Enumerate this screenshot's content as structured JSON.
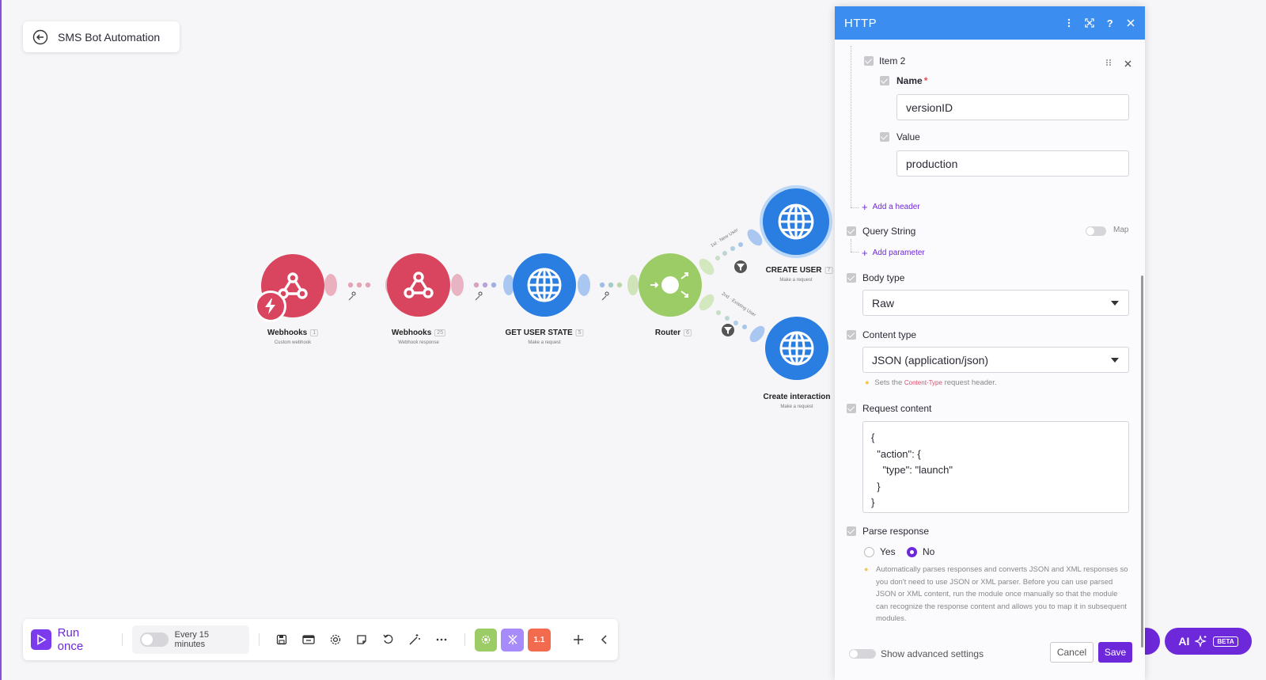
{
  "scenario": {
    "title": "SMS Bot Automation"
  },
  "nodes": [
    {
      "name": "Webhooks",
      "num": "1",
      "sub": "Custom webhook"
    },
    {
      "name": "Webhooks",
      "num": "25",
      "sub": "Webhook response"
    },
    {
      "name": "GET USER STATE",
      "num": "5",
      "sub": "Make a request"
    },
    {
      "name": "Router",
      "num": "6",
      "sub": ""
    },
    {
      "name": "CREATE USER",
      "num": "7",
      "sub": "Make a request"
    },
    {
      "name": "Create interaction",
      "num": "",
      "sub": "Make a request"
    }
  ],
  "routes": {
    "r1": "1st · New User",
    "r2": "2nd · Existing User"
  },
  "toolbar": {
    "run_once": "Run once",
    "schedule": "Every 15 minutes",
    "badge": "1.1"
  },
  "ai": {
    "label": "AI",
    "beta": "BETA"
  },
  "panel": {
    "title": "HTTP",
    "item_label": "Item 2",
    "name_label": "Name",
    "required_mark": "*",
    "name_value": "versionID",
    "value_label": "Value",
    "value_value": "production",
    "add_header": "Add a header",
    "query_string": "Query String",
    "map_label": "Map",
    "add_parameter": "Add parameter",
    "body_type_label": "Body type",
    "body_type_value": "Raw",
    "content_type_label": "Content type",
    "content_type_value": "JSON (application/json)",
    "hint_pre": "Sets the",
    "hint_code": "Content-Type",
    "hint_post": "request header.",
    "request_content_label": "Request content",
    "request_content": "{\n  \"action\": {\n    \"type\": \"launch\"\n  }\n}",
    "parse_response_label": "Parse response",
    "yes": "Yes",
    "no": "No",
    "parse_hint": "Automatically parses responses and converts JSON and XML responses so you don't need to use JSON or XML parser. Before you can use parsed JSON or XML content, run the module once manually so that the module can recognize the response content and allows you to map it in subsequent modules.",
    "advanced": "Show advanced settings",
    "cancel": "Cancel",
    "save": "Save"
  },
  "colors": {
    "accent": "#6d28d9",
    "panel_header": "#3b8ef0",
    "webhook": "#d9455e",
    "http": "#2a7de1",
    "router": "#9ccc65"
  }
}
